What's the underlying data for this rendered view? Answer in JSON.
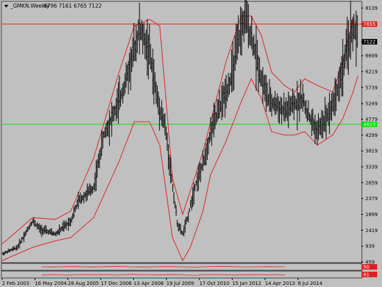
{
  "header": {
    "symbol": "_GMKN,Weekly",
    "ohlc": "6796 7161 6765 7122"
  },
  "colors": {
    "background": "#c0c0c0",
    "price_bars": "#000000",
    "bands": "#e02020",
    "resistance_line": "#e02020",
    "support_line": "#00e000",
    "current_price_tag": "#000000"
  },
  "chart_data": [
    {
      "type": "ohlc",
      "role": "main price chart",
      "ylim": [
        459,
        8300
      ],
      "y_ticks": [
        "8139",
        "7655",
        "7122",
        "6699",
        "6219",
        "5739",
        "5249",
        "4779",
        "4299",
        "3819",
        "3339",
        "2859",
        "2379",
        "1899",
        "1419",
        "939",
        "459"
      ],
      "x_tick_labels": [
        "2 Feb 2003",
        "16 May 2004",
        "28 Aug 2005",
        "17 Dec 2006",
        "13 Apr 2008",
        "19 Jul 2009",
        "17 Oct 2010",
        "15 Jan 2012",
        "14 Apr 2013",
        "6 Jul 2014"
      ],
      "horizontal_lines": [
        {
          "value": 7655,
          "label": "7655",
          "color": "#e02020"
        },
        {
          "value": 4623,
          "label": "4623",
          "color": "#00e000"
        }
      ],
      "current_price": {
        "value": 7122,
        "label": "7122"
      },
      "series_close": [
        {
          "x": "2003-02",
          "y": 700
        },
        {
          "x": "2003-08",
          "y": 900
        },
        {
          "x": "2004-02",
          "y": 1700
        },
        {
          "x": "2004-05",
          "y": 1450
        },
        {
          "x": "2004-11",
          "y": 1300
        },
        {
          "x": "2005-05",
          "y": 1700
        },
        {
          "x": "2005-08",
          "y": 2300
        },
        {
          "x": "2006-02",
          "y": 2700
        },
        {
          "x": "2006-06",
          "y": 4300
        },
        {
          "x": "2006-12",
          "y": 5300
        },
        {
          "x": "2007-04",
          "y": 6300
        },
        {
          "x": "2007-08",
          "y": 7500
        },
        {
          "x": "2007-12",
          "y": 6800
        },
        {
          "x": "2008-03",
          "y": 5400
        },
        {
          "x": "2008-06",
          "y": 4600
        },
        {
          "x": "2008-09",
          "y": 2800
        },
        {
          "x": "2008-11",
          "y": 1600
        },
        {
          "x": "2009-01",
          "y": 1300
        },
        {
          "x": "2009-03",
          "y": 1800
        },
        {
          "x": "2009-06",
          "y": 2800
        },
        {
          "x": "2009-09",
          "y": 3400
        },
        {
          "x": "2009-12",
          "y": 4400
        },
        {
          "x": "2010-04",
          "y": 5200
        },
        {
          "x": "2010-08",
          "y": 6000
        },
        {
          "x": "2010-12",
          "y": 7500
        },
        {
          "x": "2011-02",
          "y": 7800
        },
        {
          "x": "2011-05",
          "y": 7000
        },
        {
          "x": "2011-08",
          "y": 6000
        },
        {
          "x": "2011-11",
          "y": 5300
        },
        {
          "x": "2012-02",
          "y": 5200
        },
        {
          "x": "2012-05",
          "y": 5000
        },
        {
          "x": "2012-09",
          "y": 5200
        },
        {
          "x": "2012-12",
          "y": 5400
        },
        {
          "x": "2013-03",
          "y": 4800
        },
        {
          "x": "2013-06",
          "y": 4400
        },
        {
          "x": "2013-09",
          "y": 4800
        },
        {
          "x": "2013-12",
          "y": 5200
        },
        {
          "x": "2014-03",
          "y": 6000
        },
        {
          "x": "2014-06",
          "y": 7000
        },
        {
          "x": "2014-08",
          "y": 7550
        },
        {
          "x": "2014-10",
          "y": 7122
        }
      ],
      "bands": [
        {
          "role": "upper",
          "points": [
            {
              "x": "2003-02",
              "y": 1000
            },
            {
              "x": "2004-02",
              "y": 1800
            },
            {
              "x": "2004-11",
              "y": 1750
            },
            {
              "x": "2005-05",
              "y": 2000
            },
            {
              "x": "2006-02",
              "y": 3600
            },
            {
              "x": "2006-12",
              "y": 6200
            },
            {
              "x": "2007-06",
              "y": 7600
            },
            {
              "x": "2007-12",
              "y": 7800
            },
            {
              "x": "2008-04",
              "y": 7600
            },
            {
              "x": "2008-06",
              "y": 5800
            },
            {
              "x": "2008-09",
              "y": 3000
            },
            {
              "x": "2009-01",
              "y": 1900
            },
            {
              "x": "2009-04",
              "y": 2600
            },
            {
              "x": "2009-09",
              "y": 3800
            },
            {
              "x": "2009-12",
              "y": 4700
            },
            {
              "x": "2010-06",
              "y": 6500
            },
            {
              "x": "2010-12",
              "y": 7900
            },
            {
              "x": "2011-04",
              "y": 7900
            },
            {
              "x": "2011-08",
              "y": 7300
            },
            {
              "x": "2011-12",
              "y": 6200
            },
            {
              "x": "2012-05",
              "y": 5800
            },
            {
              "x": "2012-09",
              "y": 5600
            },
            {
              "x": "2013-01",
              "y": 6000
            },
            {
              "x": "2013-06",
              "y": 5800
            },
            {
              "x": "2013-12",
              "y": 5600
            },
            {
              "x": "2014-04",
              "y": 6500
            },
            {
              "x": "2014-08",
              "y": 7800
            },
            {
              "x": "2014-10",
              "y": 7600
            }
          ]
        },
        {
          "role": "lower",
          "points": [
            {
              "x": "2003-02",
              "y": 500
            },
            {
              "x": "2004-02",
              "y": 900
            },
            {
              "x": "2004-11",
              "y": 1100
            },
            {
              "x": "2005-05",
              "y": 1200
            },
            {
              "x": "2006-02",
              "y": 1800
            },
            {
              "x": "2006-12",
              "y": 3500
            },
            {
              "x": "2007-06",
              "y": 4700
            },
            {
              "x": "2007-12",
              "y": 4700
            },
            {
              "x": "2008-04",
              "y": 4000
            },
            {
              "x": "2008-09",
              "y": 1200
            },
            {
              "x": "2009-01",
              "y": 500
            },
            {
              "x": "2009-04",
              "y": 900
            },
            {
              "x": "2009-09",
              "y": 2000
            },
            {
              "x": "2009-12",
              "y": 3100
            },
            {
              "x": "2010-06",
              "y": 4100
            },
            {
              "x": "2010-12",
              "y": 5300
            },
            {
              "x": "2011-04",
              "y": 6000
            },
            {
              "x": "2011-08",
              "y": 5400
            },
            {
              "x": "2011-12",
              "y": 4400
            },
            {
              "x": "2012-05",
              "y": 4300
            },
            {
              "x": "2012-09",
              "y": 4300
            },
            {
              "x": "2013-01",
              "y": 4400
            },
            {
              "x": "2013-06",
              "y": 4000
            },
            {
              "x": "2013-12",
              "y": 4300
            },
            {
              "x": "2014-04",
              "y": 4800
            },
            {
              "x": "2014-08",
              "y": 5600
            },
            {
              "x": "2014-10",
              "y": 6100
            }
          ]
        }
      ]
    },
    {
      "type": "line",
      "role": "indicator pane 1",
      "label_left": "",
      "value_tag": "50",
      "ylim": [
        0,
        100
      ],
      "values": [
        50,
        48,
        55,
        52,
        47,
        53,
        56,
        50,
        48,
        52,
        55,
        50,
        46,
        52,
        57,
        53,
        49,
        51,
        54,
        50
      ]
    },
    {
      "type": "line",
      "role": "indicator pane 2",
      "label_left": "",
      "value_tag": "41",
      "ylim": [
        0,
        100
      ],
      "values": [
        40,
        45,
        38,
        50,
        42,
        47,
        39,
        52,
        44,
        41,
        48,
        43,
        36,
        49,
        45,
        40,
        46,
        42,
        44,
        41
      ]
    }
  ]
}
